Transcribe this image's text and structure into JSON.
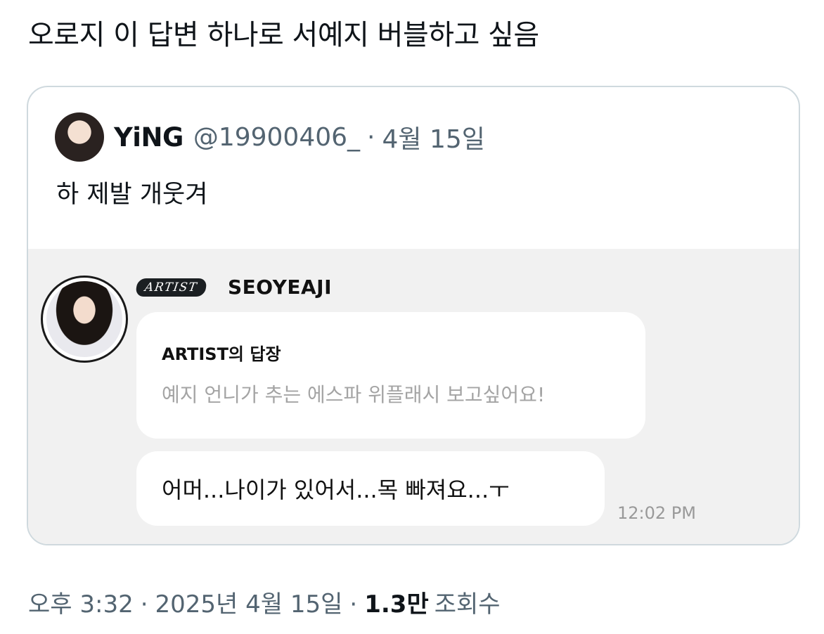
{
  "tweet": {
    "text": "오로지 이 답변 하나로 서예지 버블하고 싶음"
  },
  "quote": {
    "author_name": "YiNG",
    "handle": "@19900406_",
    "separator": "·",
    "date": "4월 15일",
    "text": "하 제발 개웃겨"
  },
  "bubble_message": {
    "badge": "ARTIST",
    "artist_name": "SEOYEAJI",
    "reply_title": "ARTIST의 답장",
    "question": "예지 언니가 추는 에스파 위플래시 보고싶어요!",
    "answer": "어머...나이가 있어서...목 빠져요...ㅜ",
    "time": "12:02 PM"
  },
  "meta": {
    "time": "오후 3:32",
    "separator": "·",
    "date": "2025년 4월 15일",
    "views_count": "1.3만",
    "views_label": "조회수"
  },
  "colors": {
    "text_primary": "#0f1419",
    "text_secondary": "#536471",
    "card_border": "#cfd9de",
    "bubble_bg": "#f1f1f1"
  }
}
